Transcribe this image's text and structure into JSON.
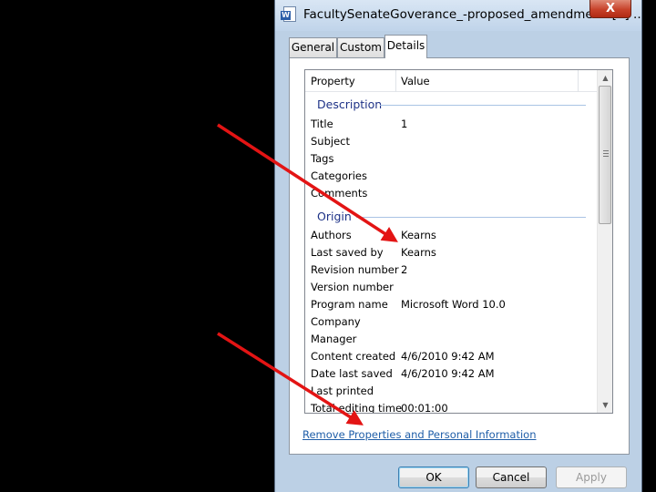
{
  "window": {
    "title": "FacultySenateGoverance_-proposed_amendments[1] ...",
    "close_glyph": "X"
  },
  "tabs": [
    {
      "label": "General",
      "active": false
    },
    {
      "label": "Custom",
      "active": false
    },
    {
      "label": "Details",
      "active": true
    }
  ],
  "details": {
    "headers": {
      "property": "Property",
      "value": "Value"
    },
    "groups": [
      {
        "title": "Description",
        "rows": [
          {
            "property": "Title",
            "value": "1"
          },
          {
            "property": "Subject",
            "value": ""
          },
          {
            "property": "Tags",
            "value": ""
          },
          {
            "property": "Categories",
            "value": ""
          },
          {
            "property": "Comments",
            "value": ""
          }
        ]
      },
      {
        "title": "Origin",
        "rows": [
          {
            "property": "Authors",
            "value": "Kearns"
          },
          {
            "property": "Last saved by",
            "value": "Kearns"
          },
          {
            "property": "Revision number",
            "value": "2"
          },
          {
            "property": "Version number",
            "value": ""
          },
          {
            "property": "Program name",
            "value": "Microsoft Word 10.0"
          },
          {
            "property": "Company",
            "value": ""
          },
          {
            "property": "Manager",
            "value": ""
          },
          {
            "property": "Content created",
            "value": "4/6/2010 9:42 AM"
          },
          {
            "property": "Date last saved",
            "value": "4/6/2010 9:42 AM"
          },
          {
            "property": "Last printed",
            "value": ""
          },
          {
            "property": "Total editing time",
            "value": "00:01:00"
          }
        ]
      }
    ]
  },
  "remove_link": "Remove Properties and Personal Information",
  "buttons": {
    "ok": "OK",
    "cancel": "Cancel",
    "apply": "Apply"
  },
  "colors": {
    "annotation_arrow": "#e31414",
    "link": "#1f5ea8",
    "group_header": "#1e3287"
  }
}
